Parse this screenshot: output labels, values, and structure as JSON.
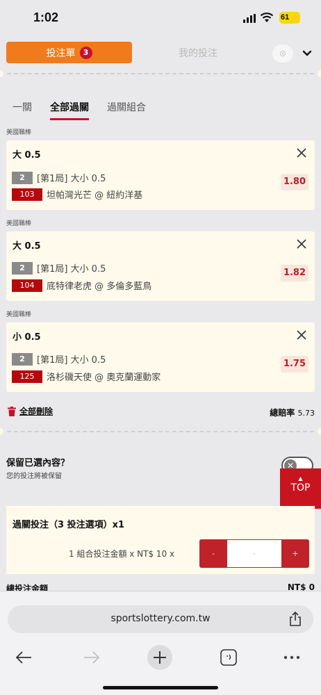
{
  "status": {
    "time": "1:02",
    "battery": "61"
  },
  "header": {
    "betslip_label": "投注單",
    "betslip_count": "3",
    "mybets_label": "我的投注"
  },
  "bet_type_tabs": [
    {
      "label": "一關",
      "active": false
    },
    {
      "label": "全部過關",
      "active": true
    },
    {
      "label": "過關組合",
      "active": false
    }
  ],
  "bets": [
    {
      "league": "美國職棒",
      "selection": "大 0.5",
      "market_code": "2",
      "market": "[第1局] 大小 0.5",
      "match_code": "103",
      "match": "坦帕灣光芒 @ 紐約洋基",
      "odds": "1.80"
    },
    {
      "league": "美國職棒",
      "selection": "大 0.5",
      "market_code": "2",
      "market": "[第1局] 大小 0.5",
      "match_code": "104",
      "match": "底特律老虎 @ 多倫多藍鳥",
      "odds": "1.82"
    },
    {
      "league": "美國職棒",
      "selection": "小 0.5",
      "market_code": "2",
      "market": "[第1局] 大小 0.5",
      "match_code": "125",
      "match": "洛杉磯天使 @ 奧克蘭運動家",
      "odds": "1.75"
    }
  ],
  "footer": {
    "delete_all": "全部刪除",
    "total_odds_label": "總賠率",
    "total_odds_value": "5.73"
  },
  "retain": {
    "title": "保留已選內容？",
    "subtitle": "您的投注將被保留"
  },
  "top_button": {
    "arrow": "▲",
    "label": "TOP"
  },
  "parlay": {
    "title": "過關投注（3 投注選項）x1",
    "stake_label": "1 組合投注金額 x NT$ 10 x",
    "minus": "-",
    "value": "-",
    "plus": "+"
  },
  "total_stake": {
    "label": "總投注金額",
    "amount": "NT$ 0"
  },
  "browser": {
    "url": "sportslottery.com.tw"
  },
  "colors": {
    "accent_orange": "#f07b1c",
    "accent_red": "#c8102e",
    "card_bg": "#fffaec"
  }
}
